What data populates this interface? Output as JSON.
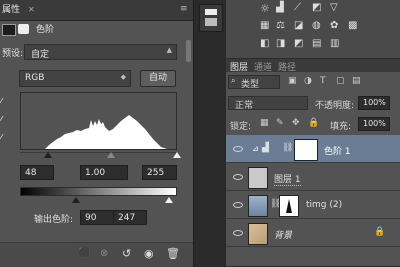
{
  "properties": {
    "tab_title": "属性",
    "adjustment_name": "色阶",
    "preset_label": "预设:",
    "preset_value": "自定",
    "channel_value": "RGB",
    "auto_label": "自动",
    "input_black": "48",
    "input_gamma": "1.00",
    "input_white": "255",
    "output_label": "输出色阶:",
    "output_black": "90",
    "output_white": "247"
  },
  "layers_panel": {
    "tabs": [
      "图层",
      "通道",
      "路径"
    ],
    "kind_filter": "类型",
    "blend_mode": "正常",
    "opacity_label": "不透明度:",
    "opacity_value": "100%",
    "lock_label": "锁定:",
    "fill_label": "填充:",
    "fill_value": "100%",
    "layers": [
      {
        "name": "色阶 1",
        "selected": true
      },
      {
        "name": "图层 1",
        "selected": false
      },
      {
        "name": "timg (2)",
        "selected": false
      },
      {
        "name": "背景",
        "selected": false
      }
    ]
  },
  "colors": {
    "accent_selected_row": "#6b7d95",
    "panel_bg": "#535353",
    "dark_bg": "#2b2b2b"
  },
  "icons": [
    "levels-icon",
    "mask-icon",
    "dropdown-icon",
    "eyedropper-icon",
    "eye-icon",
    "link-icon",
    "lock-icon",
    "trash-icon",
    "reset-icon",
    "visibility-icon"
  ]
}
